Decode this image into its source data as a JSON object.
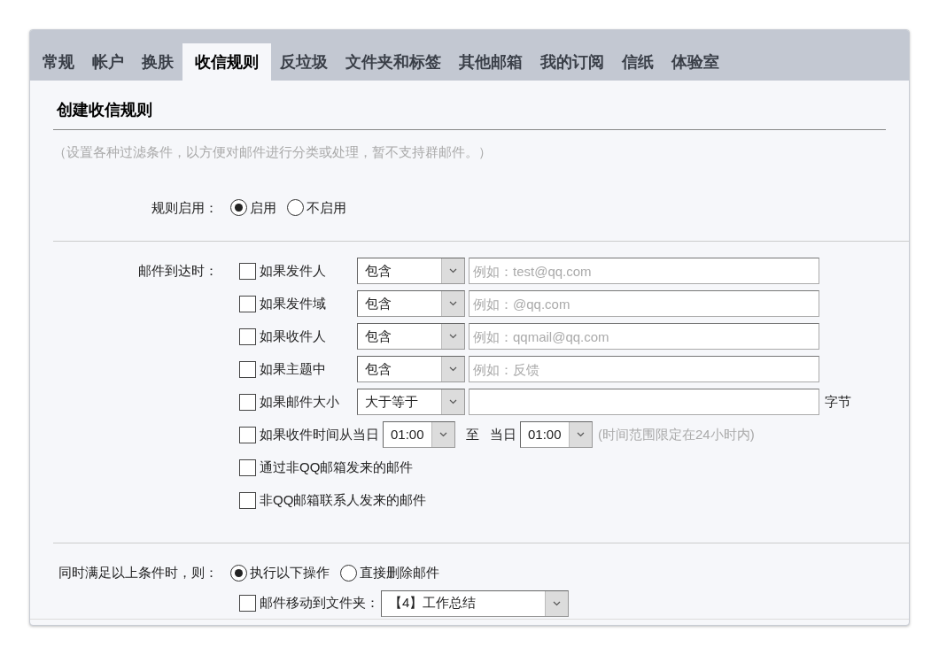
{
  "tabs": [
    {
      "label": "常规",
      "selected": false
    },
    {
      "label": "帐户",
      "selected": false
    },
    {
      "label": "换肤",
      "selected": false
    },
    {
      "label": "收信规则",
      "selected": true
    },
    {
      "label": "反垃圾",
      "selected": false
    },
    {
      "label": "文件夹和标签",
      "selected": false
    },
    {
      "label": "其他邮箱",
      "selected": false
    },
    {
      "label": "我的订阅",
      "selected": false
    },
    {
      "label": "信纸",
      "selected": false
    },
    {
      "label": "体验室",
      "selected": false
    }
  ],
  "section_title": "创建收信规则",
  "note": "（设置各种过滤条件，以方便对邮件进行分类或处理，暂不支持群邮件。）",
  "rule_enabled": {
    "label": "规则启用：",
    "options": [
      {
        "label": "启用",
        "selected": true
      },
      {
        "label": "不启用",
        "selected": false
      }
    ]
  },
  "conditions": {
    "label": "邮件到达时：",
    "items": [
      {
        "kind": "text",
        "label": "如果发件人",
        "checked": false,
        "operator": "包含",
        "placeholder": "例如：test@qq.com"
      },
      {
        "kind": "text",
        "label": "如果发件域",
        "checked": false,
        "operator": "包含",
        "placeholder": "例如：@qq.com"
      },
      {
        "kind": "text",
        "label": "如果收件人",
        "checked": false,
        "operator": "包含",
        "placeholder": "例如：qqmail@qq.com"
      },
      {
        "kind": "text",
        "label": "如果主题中",
        "checked": false,
        "operator": "包含",
        "placeholder": "例如：反馈"
      },
      {
        "kind": "size",
        "label": "如果邮件大小",
        "checked": false,
        "operator": "大于等于",
        "unit": "字节"
      },
      {
        "kind": "time",
        "label": "如果收件时间从当日",
        "checked": false,
        "from": "01:00",
        "to_label": "至",
        "day_label": "当日",
        "to": "01:00",
        "hint": "(时间范围限定在24小时内)"
      },
      {
        "kind": "plain",
        "label": "通过非QQ邮箱发来的邮件",
        "checked": false
      },
      {
        "kind": "plain",
        "label": "非QQ邮箱联系人发来的邮件",
        "checked": false
      }
    ]
  },
  "action": {
    "label": "同时满足以上条件时，则：",
    "options": [
      {
        "label": "执行以下操作",
        "selected": true
      },
      {
        "label": "直接删除邮件",
        "selected": false
      }
    ],
    "move": {
      "label": "邮件移动到文件夹：",
      "checked": false,
      "folder": "【4】工作总结"
    }
  }
}
